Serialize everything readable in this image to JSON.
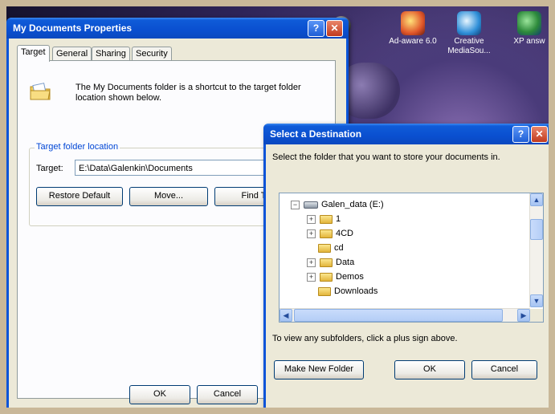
{
  "desktop": {
    "icons": [
      {
        "label": "Ad-aware 6.0",
        "icon": "adaware-icon"
      },
      {
        "label": "Creative MediaSou...",
        "icon": "creative-mediasource-icon"
      },
      {
        "label": "XP answ",
        "icon": "xp-answer-icon"
      }
    ]
  },
  "properties": {
    "title": "My Documents Properties",
    "help_label": "?",
    "close_label": "✕",
    "tabs": [
      "Target",
      "General",
      "Sharing",
      "Security"
    ],
    "description": "The My Documents folder is a shortcut to the target folder location shown below.",
    "group_label": "Target folder location",
    "target_label": "Target:",
    "target_value": "E:\\Data\\Galenkin\\Documents",
    "buttons": {
      "restore": "Restore Default",
      "move": "Move...",
      "find": "Find T"
    },
    "ok_label": "OK",
    "cancel_label": "Cancel"
  },
  "destination": {
    "title": "Select a Destination",
    "help_label": "?",
    "close_label": "✕",
    "prompt": "Select the folder that you want to store your documents in.",
    "tree": {
      "root": "Galen_data (E:)",
      "items": [
        {
          "label": "1",
          "expandable": true
        },
        {
          "label": "4CD",
          "expandable": true
        },
        {
          "label": "cd",
          "expandable": false
        },
        {
          "label": "Data",
          "expandable": true
        },
        {
          "label": "Demos",
          "expandable": true
        },
        {
          "label": "Downloads",
          "expandable": false
        }
      ]
    },
    "hint": "To view any subfolders, click a plus sign above.",
    "new_folder_label": "Make New Folder",
    "ok_label": "OK",
    "cancel_label": "Cancel"
  },
  "colors": {
    "titlebar": "#0a4fd0",
    "window_bg": "#ece9d8",
    "close_red": "#c13a1e"
  }
}
